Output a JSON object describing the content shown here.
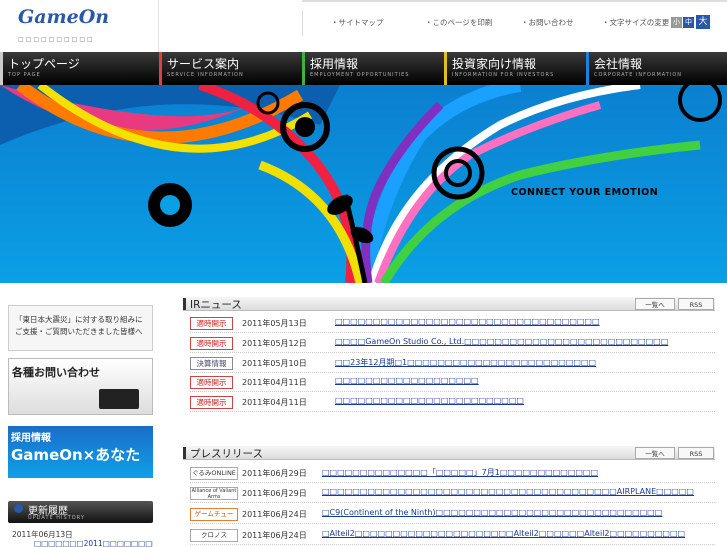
{
  "header": {
    "logo": "GameOn",
    "logo_sub": "□□□□□□□□□□",
    "util_links": [
      "・サイトマップ",
      "・このページを印刷",
      "・お問い合わせ",
      "・文字サイズの変更"
    ],
    "size_small": "小",
    "size_medium": "中",
    "size_large": "大"
  },
  "nav": [
    {
      "title": "トップページ",
      "sub": "TOP PAGE",
      "color": "#e8e8e8"
    },
    {
      "title": "サービス案内",
      "sub": "SERVICE INFORMATION",
      "color": "#e04040"
    },
    {
      "title": "採用情報",
      "sub": "EMPLOYMENT OPPORTUNITIES",
      "color": "#40b040"
    },
    {
      "title": "投資家向け情報",
      "sub": "INFORMATION FOR INVESTORS",
      "color": "#e0c020"
    },
    {
      "title": "会社情報",
      "sub": "CORPORATE INFORMATION",
      "color": "#2080e0"
    }
  ],
  "hero": {
    "tagline": "CONNECT YOUR EMOTION"
  },
  "sidebar": {
    "disaster_text": "「東日本大震災」に対する取り組みにご支援・ご質問いただきました皆様へ",
    "contact": "各種お問い合わせ",
    "recruit_title": "採用情報",
    "recruit_sub": "GameOn×あなた",
    "history_title": "更新履歴",
    "history_sub": "UPDATE HISTORY",
    "history_item_date": "2011年06月13日",
    "history_item_text": "□□□□□□□2011□□□□□□□□□□□□□"
  },
  "ir": {
    "title": "IRニュース",
    "list_btn": "一覧へ",
    "rss_btn": "RSS",
    "rows": [
      {
        "tag": "適時開示",
        "date": "2011年05月13日",
        "title": "□□□□□□□□□□□□□□□□□□□□□□□□□□□□□□□□□□□",
        "gray": false
      },
      {
        "tag": "適時開示",
        "date": "2011年05月12日",
        "title": "□□□□GameOn Studio Co., Ltd.□□□□□□□□□□□□□□□□□□□□□□□□□□□",
        "gray": false
      },
      {
        "tag": "決算情報",
        "date": "2011年05月10日",
        "title": "□□23年12月期□1□□□□□□□□□□□□□□□□□□□□□□□□□",
        "gray": true
      },
      {
        "tag": "適時開示",
        "date": "2011年04月11日",
        "title": "□□□□□□□□□□□□□□□□□□□",
        "gray": false
      },
      {
        "tag": "適時開示",
        "date": "2011年04月11日",
        "title": "□□□□□□□□□□□□□□□□□□□□□□□□□",
        "gray": false
      }
    ]
  },
  "press": {
    "title": "プレスリリース",
    "list_btn": "一覧へ",
    "rss_btn": "RSS",
    "rows": [
      {
        "tag": "ぐるみONLINE",
        "date": "2011年06月29日",
        "title": "□□□□□□□□□□□□□□「□□□□□」7月1□□□□□□□□□□□□□"
      },
      {
        "tag": "Alliance of Valiant Arms",
        "date": "2011年06月29日",
        "title": "□□□□□□□□□□□□□□□□□□□□□□□□□□□□□□□□□□□□□□□AIRPLANE□□□□□"
      },
      {
        "tag": "ゲームチュー",
        "date": "2011年06月24日",
        "title": "□C9(Continent of the Ninth)□□□□□□□□□□□□□□□□□□□□□□□□□□□□□□"
      },
      {
        "tag": "クロノス",
        "date": "2011年06月24日",
        "title": "□Alteil2□□□□□□□□□□□□□□□□□□□□□Alteil2□□□□□□Alteil2□□□□□□□□□□"
      }
    ]
  }
}
